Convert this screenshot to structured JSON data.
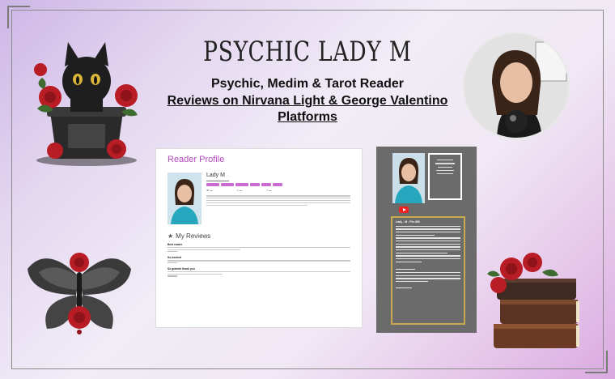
{
  "header": {
    "title": "PSYCHIC LADY M",
    "subtitle": "Psychic, Medim & Tarot Reader",
    "reviews_line": "Reviews on  Nirvana Light & George Valentino Platforms"
  },
  "profile_card": {
    "title": "Reader Profile",
    "name": "Lady M",
    "my_reviews_label": "My Reviews",
    "reviews": [
      {
        "heading": "Best reader"
      },
      {
        "heading": "So worried"
      },
      {
        "heading": "So grateful thank you"
      }
    ]
  },
  "dark_panel": {
    "info_heading": "Lady - M - Pin 406"
  },
  "colors": {
    "accent_purple": "#b44bbd",
    "gold_border": "#c8a94d",
    "panel_gray": "#6b6b6b"
  }
}
